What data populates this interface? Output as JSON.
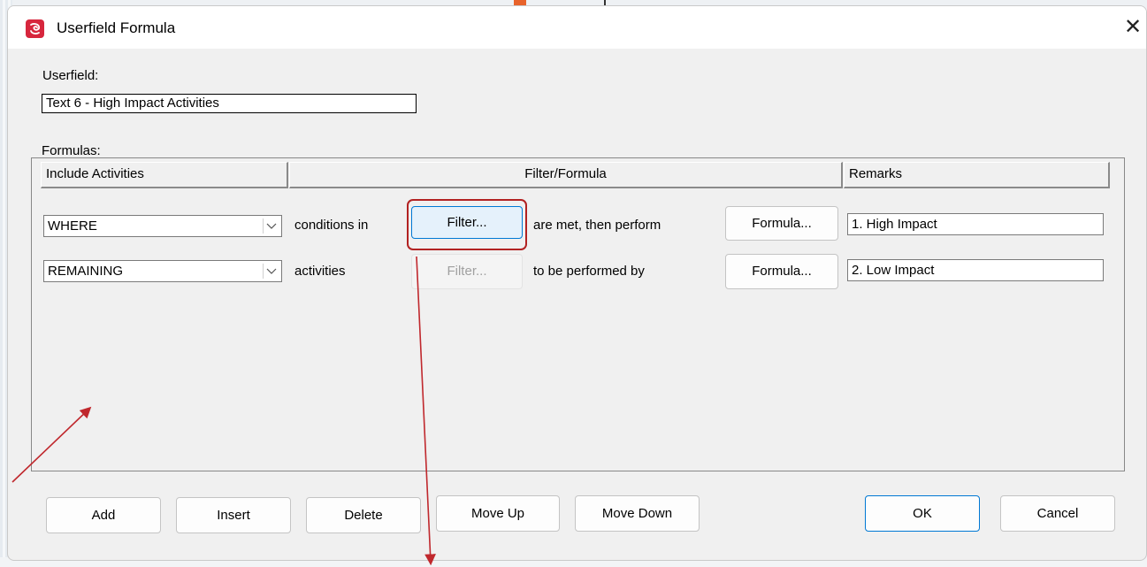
{
  "dialog": {
    "title": "Userfield Formula",
    "close_glyph": "✕",
    "icon": "app-logo-icon"
  },
  "userfield": {
    "label": "Userfield:",
    "value": "Text 6 - High Impact Activities"
  },
  "formulas": {
    "label": "Formulas:",
    "columns": [
      "Include Activities",
      "Filter/Formula",
      "Remarks"
    ],
    "rows": [
      {
        "include": "WHERE",
        "text1": "conditions in",
        "filter_button": "Filter...",
        "text2": "are met, then perform",
        "formula_button": "Formula...",
        "remarks": "1. High Impact"
      },
      {
        "include": "REMAINING",
        "text1": "activities",
        "filter_button": "Filter...",
        "text2": "to be performed by",
        "formula_button": "Formula...",
        "remarks": "2. Low Impact"
      }
    ]
  },
  "buttons": {
    "add": "Add",
    "insert": "Insert",
    "delete": "Delete",
    "move_up": "Move Up",
    "move_down": "Move Down",
    "ok": "OK",
    "cancel": "Cancel"
  },
  "colors": {
    "accent": "#0078d4",
    "annotation": "#c0282d",
    "app_icon": "#d7263d"
  }
}
